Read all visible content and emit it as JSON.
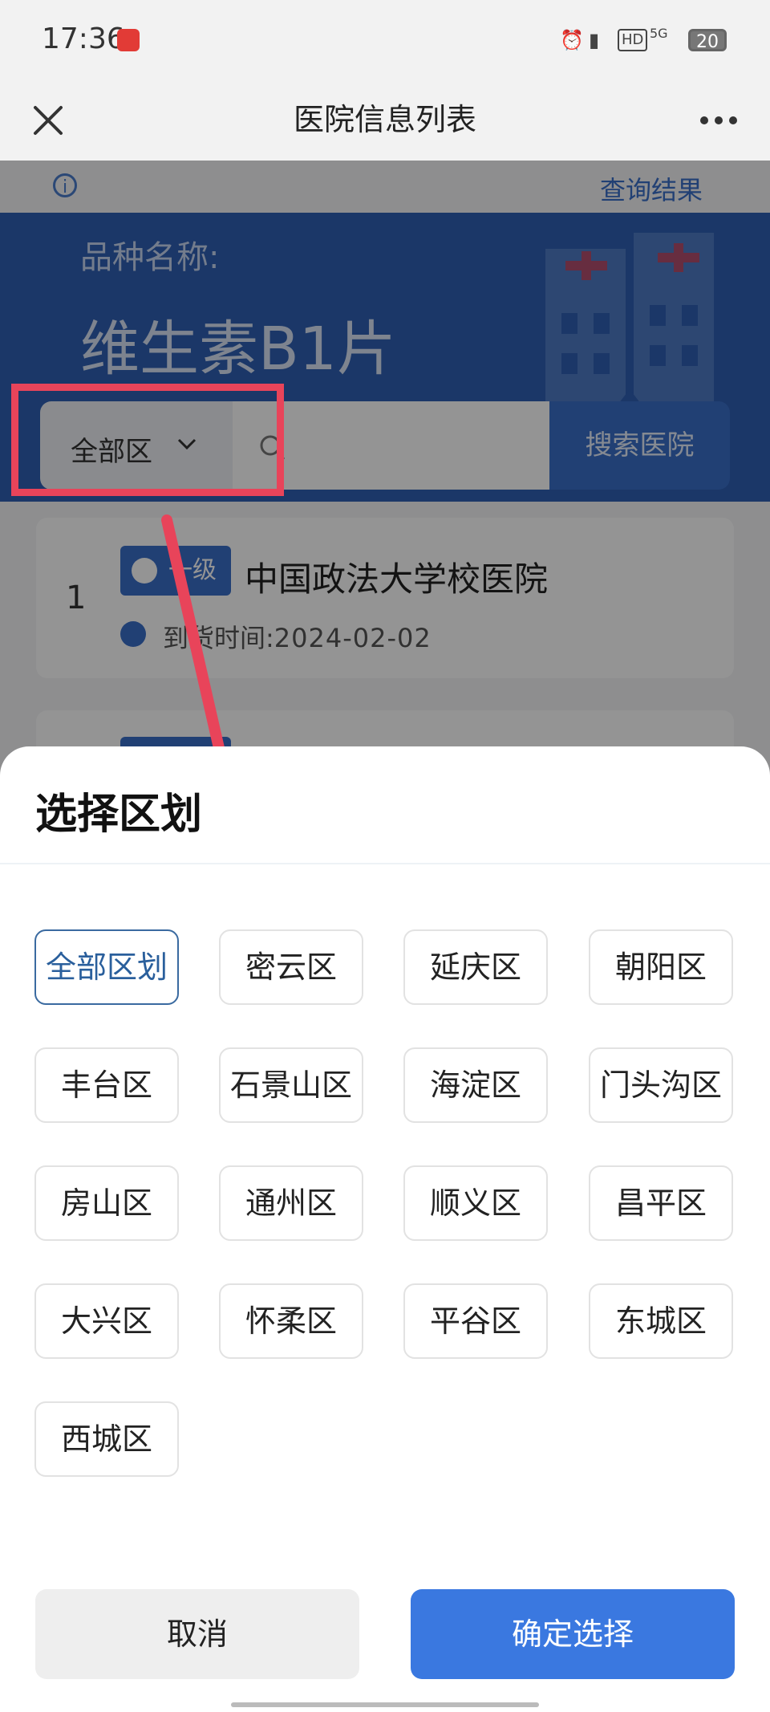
{
  "status_bar": {
    "time": "17:36",
    "network": "5G",
    "hd": "HD",
    "battery": "20"
  },
  "nav": {
    "title": "医院信息列表"
  },
  "page": {
    "result_link": "查询结果",
    "variety_label": "品种名称:",
    "variety_name": "维生素B1片",
    "district_filter": "全部区",
    "search_button": "搜索医院",
    "cards": [
      {
        "index": "1",
        "badge": "一级",
        "name": "中国政法大学校医院",
        "date_label": "到货时间:",
        "date": "2024-02-02"
      }
    ]
  },
  "sheet": {
    "title": "选择区划",
    "options": [
      "全部区划",
      "密云区",
      "延庆区",
      "朝阳区",
      "丰台区",
      "石景山区",
      "海淀区",
      "门头沟区",
      "房山区",
      "通州区",
      "顺义区",
      "昌平区",
      "大兴区",
      "怀柔区",
      "平谷区",
      "东城区",
      "西城区"
    ],
    "selected": "全部区划",
    "cancel": "取消",
    "confirm": "确定选择"
  },
  "colors": {
    "accent": "#3a78e0",
    "banner": "#2f5fb3",
    "annotation": "#e8445a"
  },
  "icons": [
    "close-icon",
    "more-icon",
    "info-icon",
    "chevron-down-icon",
    "search-icon",
    "clock-icon",
    "hospital-illustration",
    "annotation-arrow"
  ]
}
